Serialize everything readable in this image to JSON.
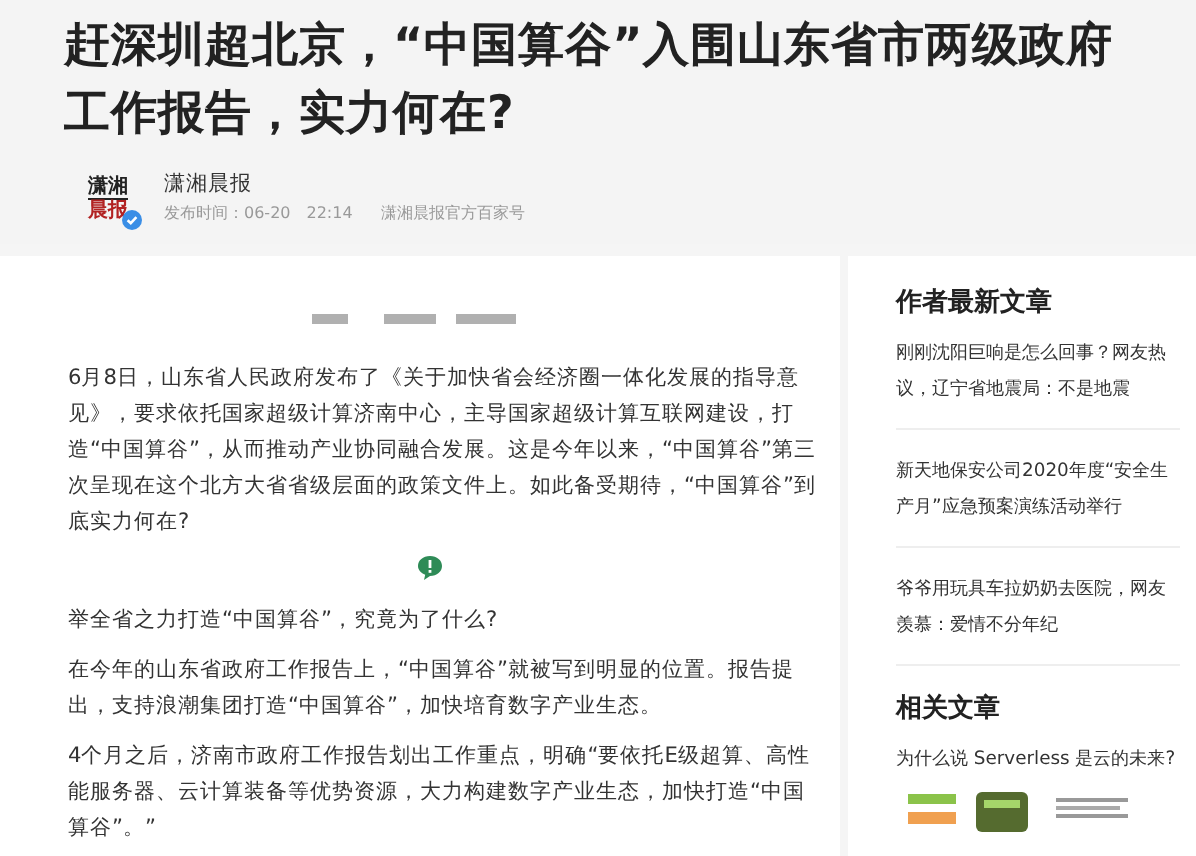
{
  "article": {
    "title": "赶深圳超北京，“中国算谷”入围山东省市两级政府工作报告，实力何在?",
    "author": {
      "logo_top": "潇湘",
      "logo_bottom": "晨报",
      "verified": true,
      "name": "潇湘晨报",
      "published_label": "发布时间：",
      "date": "06-20",
      "time": "22:14",
      "source": "潇湘晨报官方百家号"
    },
    "paragraphs": [
      {
        "kind": "text",
        "text": "6月8日，山东省人民政府发布了《关于加快省会经济圈一体化发展的指导意见》，要求依托国家超级计算济南中心，主导国家超级计算互联网建设，打造“中国算谷”，从而推动产业协同融合发展。这是今年以来，“中国算谷”第三次呈现在这个北方大省省级层面的政策文件上。如此备受期待，“中国算谷”到底实力何在?"
      },
      {
        "kind": "divider"
      },
      {
        "kind": "text",
        "text": "举全省之力打造“中国算谷”，究竟为了什么?"
      },
      {
        "kind": "text",
        "text": "在今年的山东省政府工作报告上，“中国算谷”就被写到明显的位置。报告提出，支持浪潮集团打造“中国算谷”，加快培育数字产业生态。"
      },
      {
        "kind": "text",
        "text": "4个月之后，济南市政府工作报告划出工作重点，明确“要依托E级超算、高性能服务器、云计算装备等优势资源，大力构建数字产业生态，加快打造“中国算谷”。”"
      }
    ]
  },
  "sidebar": [
    {
      "title": "作者最新文章",
      "items": [
        {
          "text": "刚刚沈阳巨响是怎么回事？网友热议，辽宁省地震局：不是地震"
        },
        {
          "text": "新天地保安公司2020年度“安全生产月”应急预案演练活动举行"
        },
        {
          "text": "爷爷用玩具车拉奶奶去医院，网友羡慕：爱情不分年纪"
        }
      ]
    },
    {
      "title": "相关文章",
      "items": [
        {
          "text": "为什么说 Serverless 是云的未来?",
          "kind": "picture"
        }
      ]
    }
  ]
}
